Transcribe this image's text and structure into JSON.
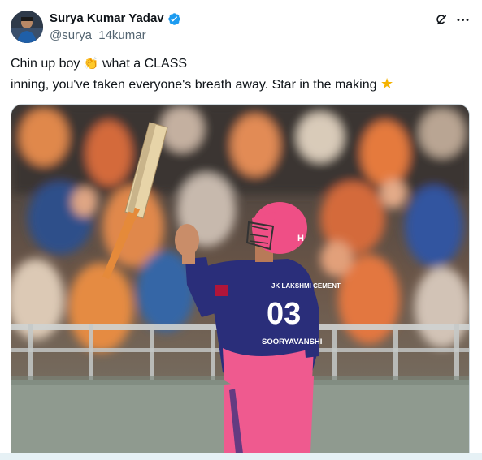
{
  "author": {
    "display_name": "Surya Kumar Yadav",
    "handle": "@surya_14kumar",
    "verified": true
  },
  "tweet": {
    "text_line1_prefix": "Chin up boy",
    "text_line1_suffix": "what a CLASS",
    "text_line2": "inning, you've taken everyone's breath away. Star in the making",
    "emoji_clap": "👏",
    "emoji_star": "★"
  },
  "media": {
    "jersey_sponsor": "JK LAKSHMI CEMENT",
    "jersey_number": "03",
    "jersey_name": "SOORYAVANSHI",
    "helmet_logo": "H"
  },
  "colors": {
    "verified_blue": "#1d9bf0",
    "jersey_pink": "#ef5a8f",
    "jersey_navy": "#2a2e7a",
    "helmet_pink": "#ef4f86",
    "crowd_orange": "#e0884c"
  },
  "icons": {
    "grok": "grok-icon",
    "more": "more-icon",
    "verified": "verified-badge-icon"
  }
}
